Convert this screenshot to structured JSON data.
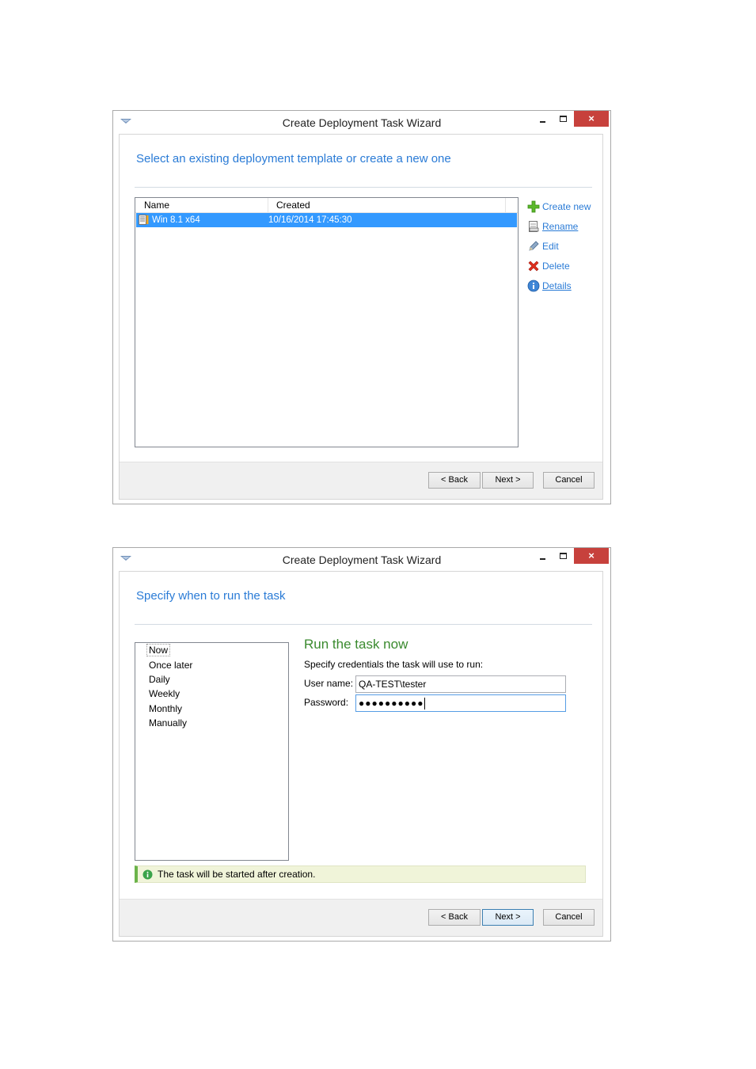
{
  "windows": [
    {
      "title": "Create Deployment Task Wizard",
      "close_glyph": "×",
      "header": "Select an existing deployment template or create a new one",
      "list": {
        "columns": [
          "Name",
          "Created"
        ],
        "rows": [
          {
            "name": "Win 8.1 x64",
            "created": "10/16/2014 17:45:30",
            "selected": true
          }
        ]
      },
      "actions": [
        {
          "label": "Create new",
          "icon": "green-plus-icon"
        },
        {
          "label": "Rename",
          "icon": "rename-icon",
          "underline": true
        },
        {
          "label": "Edit",
          "icon": "pencil-icon"
        },
        {
          "label": "Delete",
          "icon": "red-x-icon"
        },
        {
          "label": "Details",
          "icon": "info-icon",
          "underline": true
        }
      ],
      "buttons": {
        "back": "< Back",
        "next": "Next >",
        "cancel": "Cancel"
      }
    },
    {
      "title": "Create Deployment Task Wizard",
      "close_glyph": "×",
      "header": "Specify when to run the task",
      "schedule_options": [
        "Now",
        "Once later",
        "Daily",
        "Weekly",
        "Monthly",
        "Manually"
      ],
      "selected_option": "Now",
      "panel": {
        "title": "Run the task now",
        "subtitle": "Specify credentials the task will use to run:",
        "username_label": "User name:",
        "username_value": "QA-TEST\\tester",
        "password_label": "Password:",
        "password_mask": "●●●●●●●●●●"
      },
      "info": "The task will be started after creation.",
      "buttons": {
        "back": "< Back",
        "next": "Next >",
        "cancel": "Cancel"
      }
    }
  ],
  "colors": {
    "accent_blue": "#2a7bd6",
    "selection": "#3399ff",
    "close_red": "#c7413c",
    "success_green": "#3a8a2e",
    "info_bg": "#f0f4d9"
  }
}
